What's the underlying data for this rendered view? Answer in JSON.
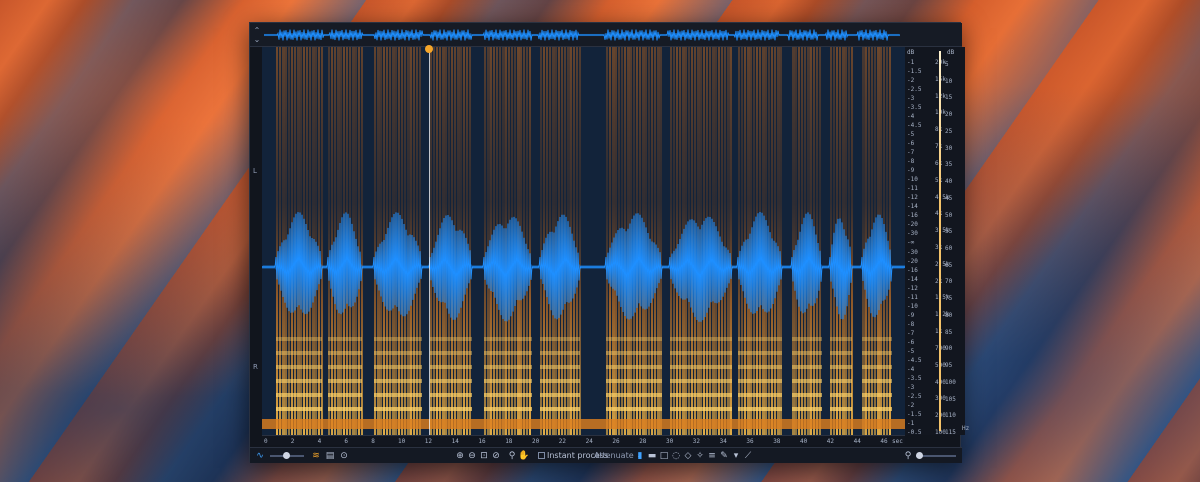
{
  "app": {
    "channels": [
      "L",
      "R"
    ],
    "colors": {
      "waveform": "#1e8fff",
      "spectrum_hot": "#ff9a1f",
      "playhead": "#f4a52a"
    },
    "overview_toggle_icon": "chevron-updown-icon"
  },
  "rulers": {
    "db_label": "dB",
    "db_ticks": [
      "-1",
      "-1.5",
      "-2",
      "-2.5",
      "-3",
      "-3.5",
      "-4",
      "-4.5",
      "-5",
      "-6",
      "-7",
      "-8",
      "-9",
      "-10",
      "-11",
      "-12",
      "-14",
      "-16",
      "-20",
      "-30",
      "-∞",
      "-30",
      "-20",
      "-16",
      "-14",
      "-12",
      "-11",
      "-10",
      "-9",
      "-8",
      "-7",
      "-6",
      "-5",
      "-4.5",
      "-4",
      "-3.5",
      "-3",
      "-2.5",
      "-2",
      "-1.5",
      "-1",
      "-0.5"
    ],
    "hz_label": "Hz",
    "hz_ticks": [
      "20k",
      "15k",
      "12k",
      "10k",
      "8k",
      "7k",
      "6k",
      "5k",
      "4.5k",
      "4k",
      "3.5k",
      "3k",
      "2.5k",
      "2k",
      "1.5k",
      "1.2k",
      "1k",
      "700",
      "500",
      "400",
      "300",
      "200",
      "100"
    ],
    "level_label": "dB",
    "level_ticks": [
      "5",
      "10",
      "15",
      "20",
      "25",
      "30",
      "35",
      "40",
      "45",
      "50",
      "55",
      "60",
      "65",
      "70",
      "75",
      "80",
      "85",
      "90",
      "95",
      "100",
      "105",
      "110",
      "115"
    ]
  },
  "timeline": {
    "ticks": [
      "0",
      "2",
      "4",
      "6",
      "8",
      "10",
      "12",
      "14",
      "16",
      "18",
      "20",
      "22",
      "24",
      "26",
      "28",
      "30",
      "32",
      "34",
      "36",
      "38",
      "40",
      "42",
      "44",
      "46"
    ],
    "unit": "sec"
  },
  "toolbar": {
    "instant_process_label": "Instant process",
    "mode_value": "Attenuate",
    "left_icons": [
      "waveform-icon",
      "zoom-slider",
      "spectrogram-icon",
      "grid-icon",
      "settings-icon"
    ],
    "tools": [
      "zoom-in-icon",
      "zoom-out-icon",
      "fit-icon",
      "zoom-selection-icon",
      "magnify-icon",
      "hand-icon"
    ],
    "select_tools": [
      "time-select-icon",
      "freq-select-icon",
      "rect-select-icon",
      "lasso-icon",
      "brush-icon",
      "wand-icon",
      "harmonic-icon",
      "pen-icon",
      "triangle-down-icon",
      "curve-icon"
    ]
  }
}
